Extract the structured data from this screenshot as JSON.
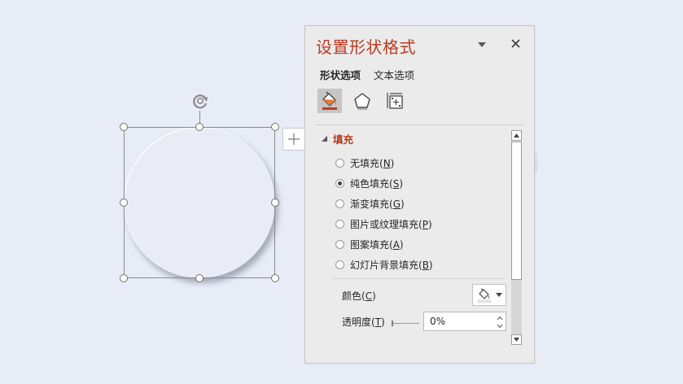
{
  "pane": {
    "title": "设置形状格式",
    "tabs": [
      "形状选项",
      "文本选项"
    ],
    "icons": [
      "fill-line-icon",
      "effects-icon",
      "size-properties-icon"
    ]
  },
  "fill_section": {
    "title": "填充",
    "options": [
      {
        "text": "无填充(",
        "key": "N",
        "selected": false
      },
      {
        "text": "纯色填充(",
        "key": "S",
        "selected": true
      },
      {
        "text": "渐变填充(",
        "key": "G",
        "selected": false
      },
      {
        "text": "图片或纹理填充(",
        "key": "P",
        "selected": false
      },
      {
        "text": "图案填充(",
        "key": "A",
        "selected": false
      },
      {
        "text": "幻灯片背景填充(",
        "key": "B",
        "selected": false
      }
    ],
    "color_label": {
      "text": "颜色(",
      "key": "C"
    },
    "transparency_label": {
      "text": "透明度(",
      "key": "T"
    },
    "transparency_value": "0%"
  },
  "colors": {
    "accent": "#b83a1f",
    "canvas": "#e8ecf7",
    "pane_bg": "#ebebeb"
  }
}
